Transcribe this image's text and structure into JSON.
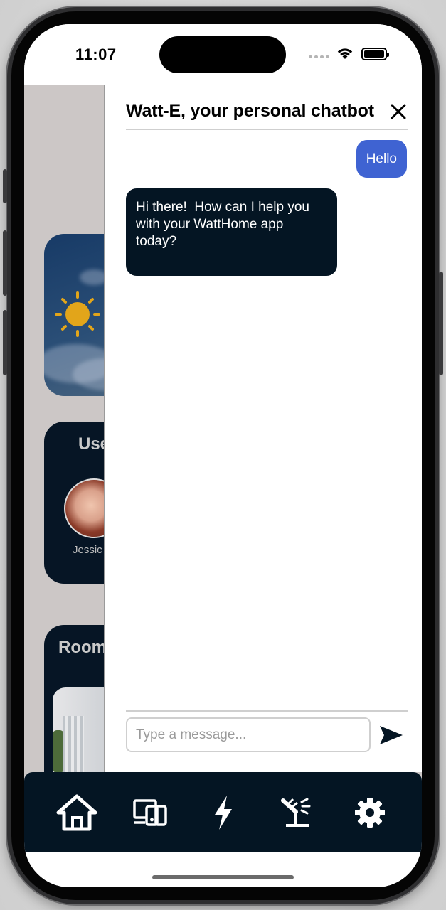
{
  "status_bar": {
    "time": "11:07"
  },
  "background_app": {
    "users_title": "Use",
    "user_name": "Jessic",
    "rooms_title": "Room"
  },
  "chat": {
    "title": "Watt-E, your personal chatbot",
    "messages": [
      {
        "sender": "user",
        "text": "Hello"
      },
      {
        "sender": "bot",
        "text": "Hi there!  How can I help you\nwith your WattHome app\ntoday?"
      }
    ],
    "input": {
      "value": "",
      "placeholder": "Type a message..."
    }
  },
  "tab_bar": {
    "items": [
      {
        "icon": "home-icon"
      },
      {
        "icon": "devices-icon"
      },
      {
        "icon": "energy-icon"
      },
      {
        "icon": "solar-panel-icon"
      },
      {
        "icon": "gear-icon"
      }
    ]
  },
  "colors": {
    "user_bubble": "#3f63d2",
    "bot_bubble": "#041523",
    "tab_bar": "#041523"
  }
}
